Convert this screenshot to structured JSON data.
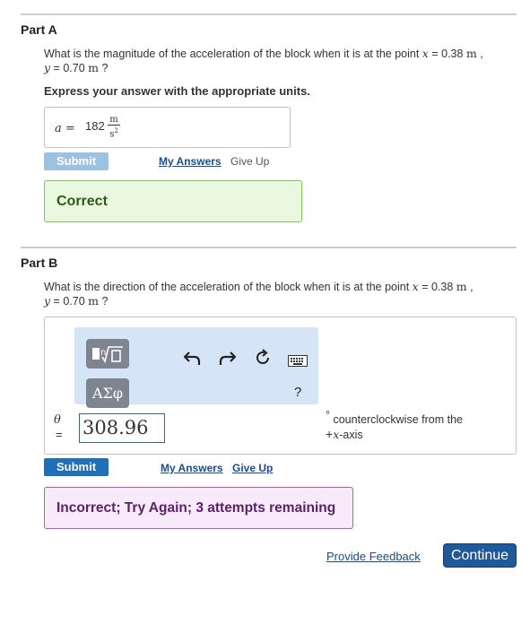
{
  "partA": {
    "title": "Part A",
    "question_pre": "What is the magnitude of the acceleration of the block when it is at the point",
    "x_var": "x",
    "x_eq": "= 0.38",
    "x_unit": "m",
    "comma": ",",
    "y_var": "y",
    "y_eq": "= 0.70",
    "y_unit": "m",
    "qmark": "?",
    "instruction": "Express your answer with the appropriate units.",
    "answer_label": "a =",
    "answer_value": "182",
    "unit_num": "m",
    "unit_den": "s2",
    "submit_label": "Submit",
    "my_answers_label": "My Answers",
    "give_up_label": "Give Up",
    "feedback": "Correct"
  },
  "partB": {
    "title": "Part B",
    "question_pre": "What is the direction of the acceleration of the block when it is at the point",
    "x_var": "x",
    "x_eq": "= 0.38",
    "x_unit": "m",
    "comma": ",",
    "y_var": "y",
    "y_eq": "= 0.70",
    "y_unit": "m",
    "qmark": "?",
    "toolbar": {
      "templates_icon": "templates-icon",
      "greek_label": "ΑΣφ",
      "undo_icon": "undo-icon",
      "redo_icon": "redo-icon",
      "reset_icon": "reset-icon",
      "keyboard_icon": "keyboard-icon",
      "help_label": "?"
    },
    "answer_label": "θ",
    "answer_eq": "=",
    "answer_value": "308.96",
    "unit_degree": "°",
    "unit_text_1": "counterclockwise from the",
    "unit_text_2_sign": "+",
    "unit_text_2_var": "x",
    "unit_text_2_rest": "-axis",
    "submit_label": "Submit",
    "my_answers_label": "My Answers",
    "give_up_label": "Give Up",
    "feedback": "Incorrect; Try Again; 3 attempts remaining"
  },
  "footer": {
    "provide_feedback_label": "Provide Feedback",
    "continue_label": "Continue"
  }
}
